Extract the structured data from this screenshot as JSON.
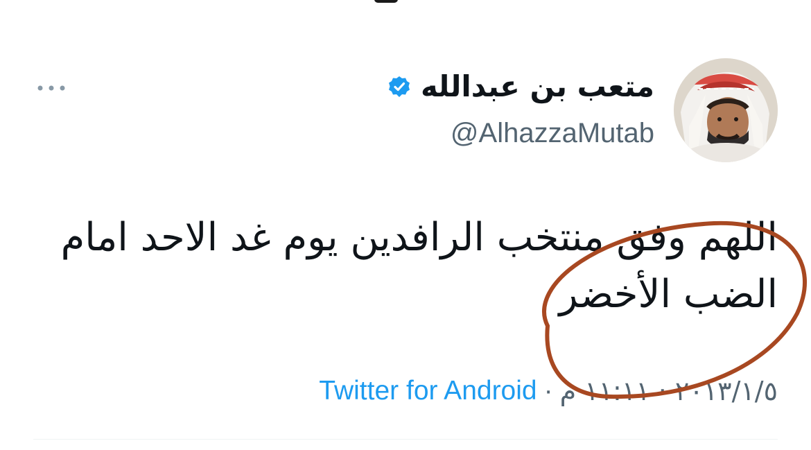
{
  "tweet": {
    "display_name": "متعب بن عبدالله",
    "handle": "@AlhazzaMutab",
    "text": "اللهم وفق منتخب الرافدين يوم غد الاحد امام\nالضب الأخضر",
    "timestamp": "٢٠١٣/١/٥ · ١١:١١ م",
    "separator": "·",
    "source": "Twitter for Android"
  },
  "icons": {
    "verified": "verified-badge-icon",
    "more": "more-dots-icon"
  },
  "colors": {
    "text_primary": "#0f1419",
    "text_secondary": "#536471",
    "link": "#1d9bf0",
    "verified": "#1d9bf0",
    "annotation": "#a84821"
  }
}
